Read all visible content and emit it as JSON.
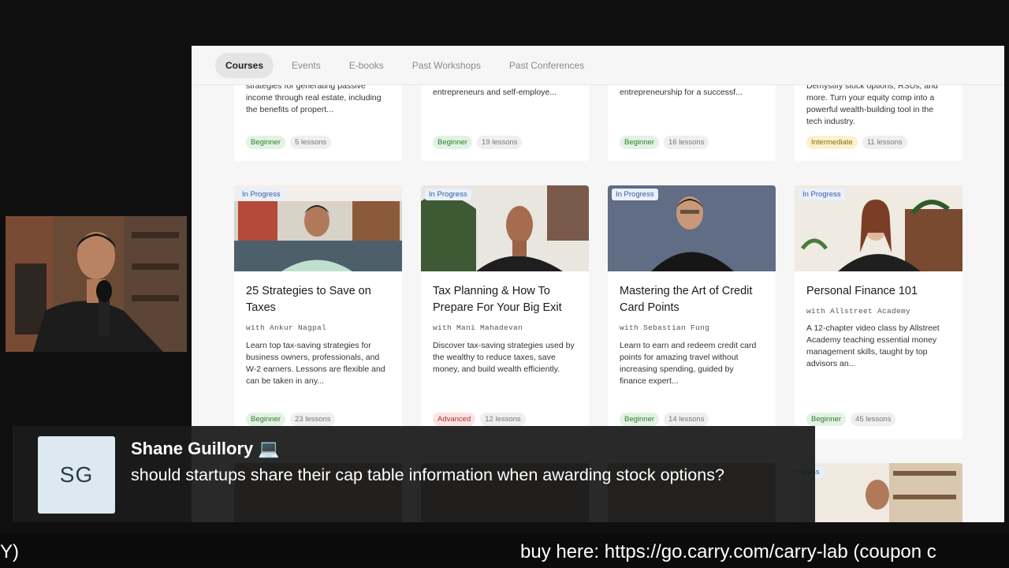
{
  "nav": {
    "tabs": [
      {
        "label": "Courses",
        "active": true
      },
      {
        "label": "Events",
        "active": false
      },
      {
        "label": "E-books",
        "active": false
      },
      {
        "label": "Past Workshops",
        "active": false
      },
      {
        "label": "Past Conferences",
        "active": false
      }
    ]
  },
  "top_row": [
    {
      "desc": "strategies for generating passive income through real estate, including the benefits of propert...",
      "level": "Beginner",
      "lessons": "5 lessons"
    },
    {
      "desc": "entrepreneurs and self-employe...",
      "level": "Beginner",
      "lessons": "19 lessons"
    },
    {
      "desc": "entrepreneurship for a successf...",
      "level": "Beginner",
      "lessons": "16 lessons"
    },
    {
      "desc": "Demystify stock options, RSUs, and more. Turn your equity comp into a powerful wealth-building tool in the tech industry.",
      "level": "Intermediate",
      "lessons": "11 lessons"
    }
  ],
  "courses": [
    {
      "badge": "In Progress",
      "title": "25 Strategies to Save on Taxes",
      "author": "with Ankur Nagpal",
      "desc": "Learn top tax-saving strategies for business owners, professionals, and W-2 earners. Lessons are flexible and can be taken in any...",
      "level": "Beginner",
      "lessons": "23 lessons"
    },
    {
      "badge": "In Progress",
      "title": "Tax Planning & How To Prepare For Your Big Exit",
      "author": "with Mani Mahadevan",
      "desc": "Discover tax-saving strategies used by the wealthy to reduce taxes, save money, and build wealth efficiently.",
      "level": "Advanced",
      "lessons": "12 lessons"
    },
    {
      "badge": "In Progress",
      "title": "Mastering the Art of Credit Card Points",
      "author": "with Sebastian Fung",
      "desc": "Learn to earn and redeem credit card points for amazing travel without increasing spending, guided by finance expert...",
      "level": "Beginner",
      "lessons": "14 lessons"
    },
    {
      "badge": "In Progress",
      "title": "Personal Finance 101",
      "author": "with Allstreet Academy",
      "desc": "A 12-chapter video class by Allstreet Academy teaching essential money management skills, taught by top advisors an...",
      "level": "Beginner",
      "lessons": "45 lessons"
    }
  ],
  "bottom_badge": "rogress",
  "chat": {
    "initials": "SG",
    "name": "Shane Guillory 💻",
    "message": "should startups share their cap table information when awarding stock options?"
  },
  "ticker": {
    "left": "Y)",
    "right": "buy here: https://go.carry.com/carry-lab (coupon c"
  },
  "colors": {
    "background": "#0f0f0f",
    "screen": "#f6f6f6",
    "card": "#ffffff",
    "badge_blue": "#e8f0fb",
    "beginner": "#e3f3e3",
    "intermediate": "#fbf1cc",
    "advanced": "#fbe3e3"
  }
}
